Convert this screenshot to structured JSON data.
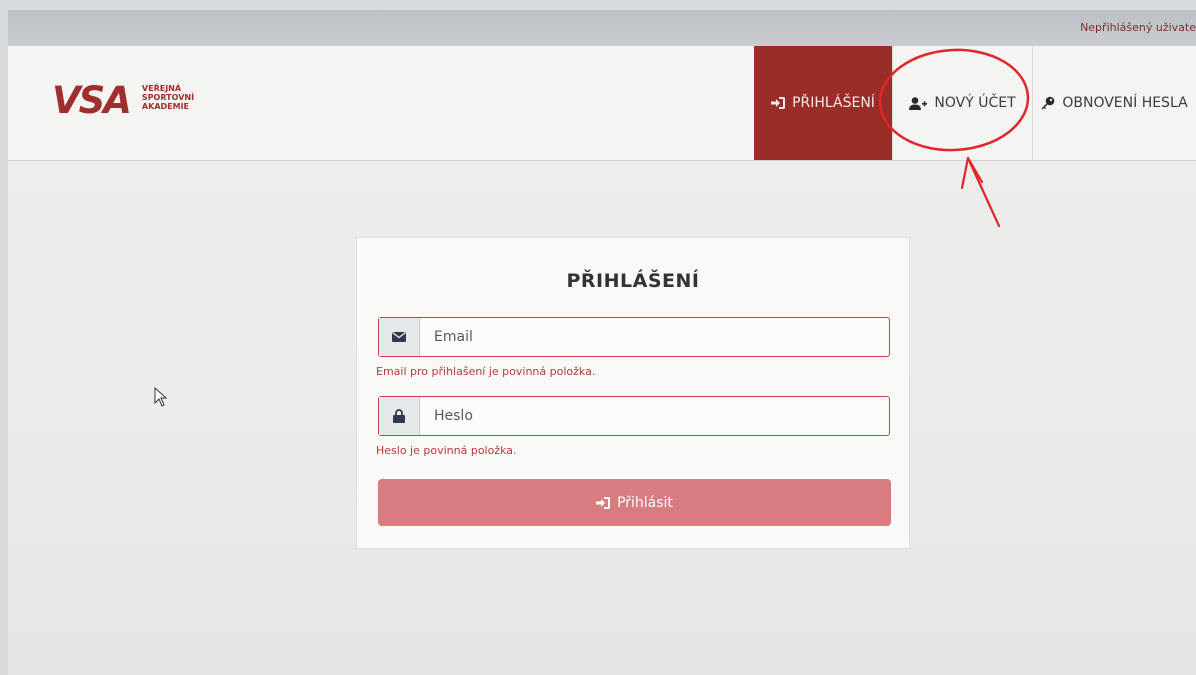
{
  "topbar": {
    "user_status": "Nepřihlášený uživate"
  },
  "logo": {
    "mark": "VSA",
    "line1": "VEŘEJNÁ",
    "line2": "SPORTOVNÍ",
    "line3": "AKADEMIE"
  },
  "nav": {
    "login_label": "PŘIHLÁŠENÍ",
    "new_account_label": "NOVÝ ÚČET",
    "reset_label": "OBNOVENÍ HESLA"
  },
  "form": {
    "title": "PŘIHLÁŠENÍ",
    "email": {
      "placeholder": "Email",
      "value": "",
      "icon": "envelope-icon",
      "error": "Email pro přihlašení je povinná položka."
    },
    "password": {
      "placeholder": "Heslo",
      "value": "",
      "icon": "lock-icon",
      "error": "Heslo je povinná položka."
    },
    "submit_label": "Přihlásit"
  },
  "colors": {
    "brand": "#a12e2e",
    "active_nav": "#9a2c27",
    "submit_bg": "#d97c80",
    "error": "#b63b3b",
    "annotation": "#e0262a"
  }
}
